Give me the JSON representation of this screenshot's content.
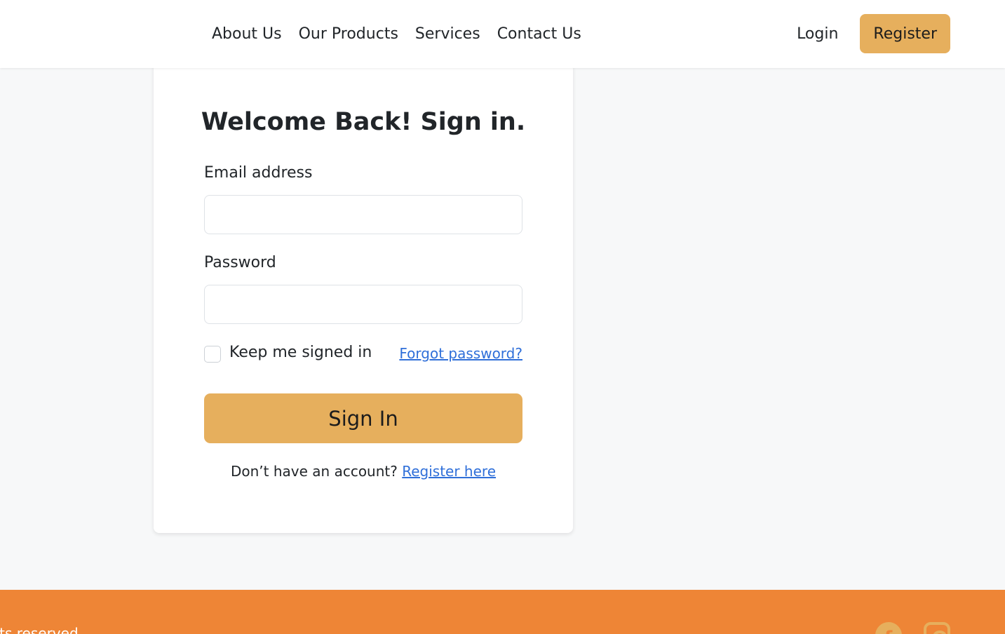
{
  "nav": {
    "links": [
      "About Us",
      "Our Products",
      "Services",
      "Contact Us"
    ],
    "login_label": "Login",
    "register_label": "Register"
  },
  "form": {
    "title": "Welcome Back! Sign in.",
    "email_label": "Email address",
    "email_value": "",
    "password_label": "Password",
    "password_value": "",
    "keep_signed_in_label": "Keep me signed in",
    "keep_signed_in_checked": false,
    "forgot_label": "Forgot password?",
    "submit_label": "Sign In",
    "no_account_text": "Don’t have an account?",
    "register_link_label": "Register here"
  },
  "footer": {
    "text": "rights reserved",
    "social_icons": [
      "facebook-icon",
      "instagram-icon"
    ]
  },
  "colors": {
    "accent": "#e6af5d",
    "footer_bg": "#ee8536",
    "link": "#2f6fd9",
    "page_bg": "#f7f8f9"
  }
}
